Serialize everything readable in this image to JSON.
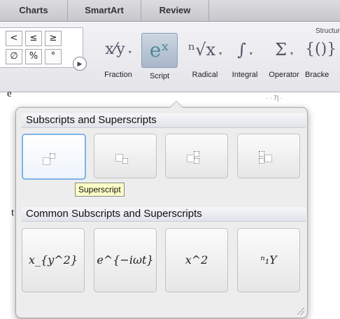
{
  "ribbon": {
    "tabs": [
      "Charts",
      "SmartArt",
      "Review"
    ],
    "group_label": "Structur",
    "symbols": [
      "<",
      "≤",
      "≥",
      "∅",
      "%",
      "°"
    ],
    "tools": [
      {
        "label": "Fraction"
      },
      {
        "label": "Script"
      },
      {
        "label": "Radical"
      },
      {
        "label": "Integral"
      },
      {
        "label": "Operator"
      },
      {
        "label": "Bracke"
      }
    ],
    "ruler_text": "· · 7| ·"
  },
  "popup": {
    "section1": "Subscripts and Superscripts",
    "section2": "Common Subscripts and Superscripts",
    "tooltip": "Superscript",
    "common": [
      {
        "formula": "x_{y^2}"
      },
      {
        "formula": "e^{−iωt}"
      },
      {
        "formula": "x^2"
      },
      {
        "formula": "ⁿ₁Y"
      }
    ]
  },
  "stray_chars": [
    "e",
    "t"
  ]
}
